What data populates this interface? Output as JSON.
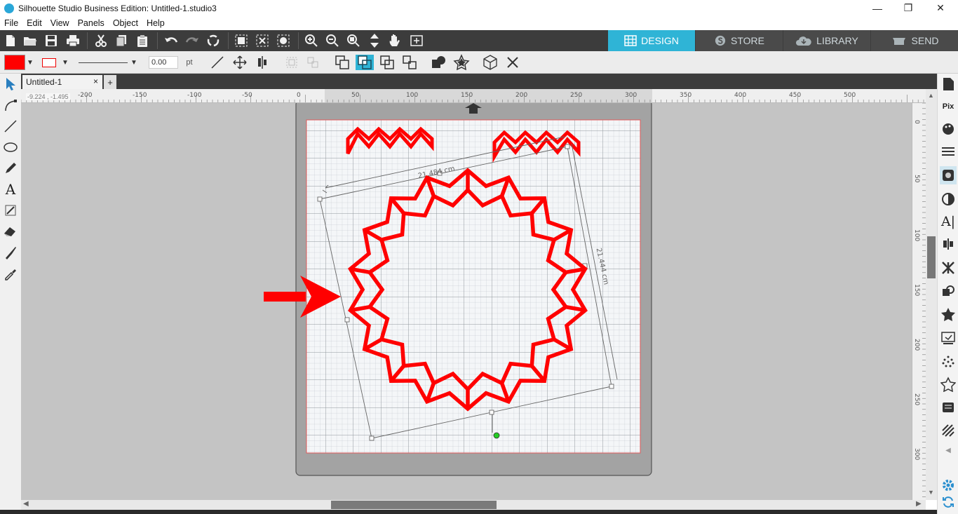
{
  "window": {
    "title": "Silhouette Studio Business Edition: Untitled-1.studio3",
    "minimize": "—",
    "maximize": "❐",
    "close": "✕"
  },
  "menu": [
    "File",
    "Edit",
    "View",
    "Panels",
    "Object",
    "Help"
  ],
  "nav_tabs": [
    {
      "label": "DESIGN",
      "active": true
    },
    {
      "label": "STORE",
      "active": false
    },
    {
      "label": "LIBRARY",
      "active": false
    },
    {
      "label": "SEND",
      "active": false
    }
  ],
  "line_style": {
    "fill_color": "#ff0000",
    "line_color": "#e00000",
    "line_width_value": "0.00",
    "line_width_unit": "pt"
  },
  "document_tab": {
    "label": "Untitled-1",
    "close": "×",
    "add": "+"
  },
  "coordinate_readout": "-9.224 , -1.495",
  "ruler": {
    "horizontal_labels": [
      "-200",
      "-150",
      "-100",
      "-50",
      "0",
      "50",
      "100",
      "150",
      "200",
      "250",
      "300",
      "350",
      "400",
      "450",
      "500"
    ],
    "vertical_labels": [
      "0",
      "50",
      "100",
      "150",
      "200",
      "250",
      "300"
    ]
  },
  "design": {
    "dimension_width": "21.484 cm",
    "dimension_height": "21.444 cm",
    "accent_red": "#ff0000",
    "rotation_handle_color": "#22cc22"
  },
  "colors": {
    "design_tab": "#2fb4d6",
    "toolbar_dark": "#3c3c3c",
    "canvas_bg": "#c4c4c4"
  }
}
